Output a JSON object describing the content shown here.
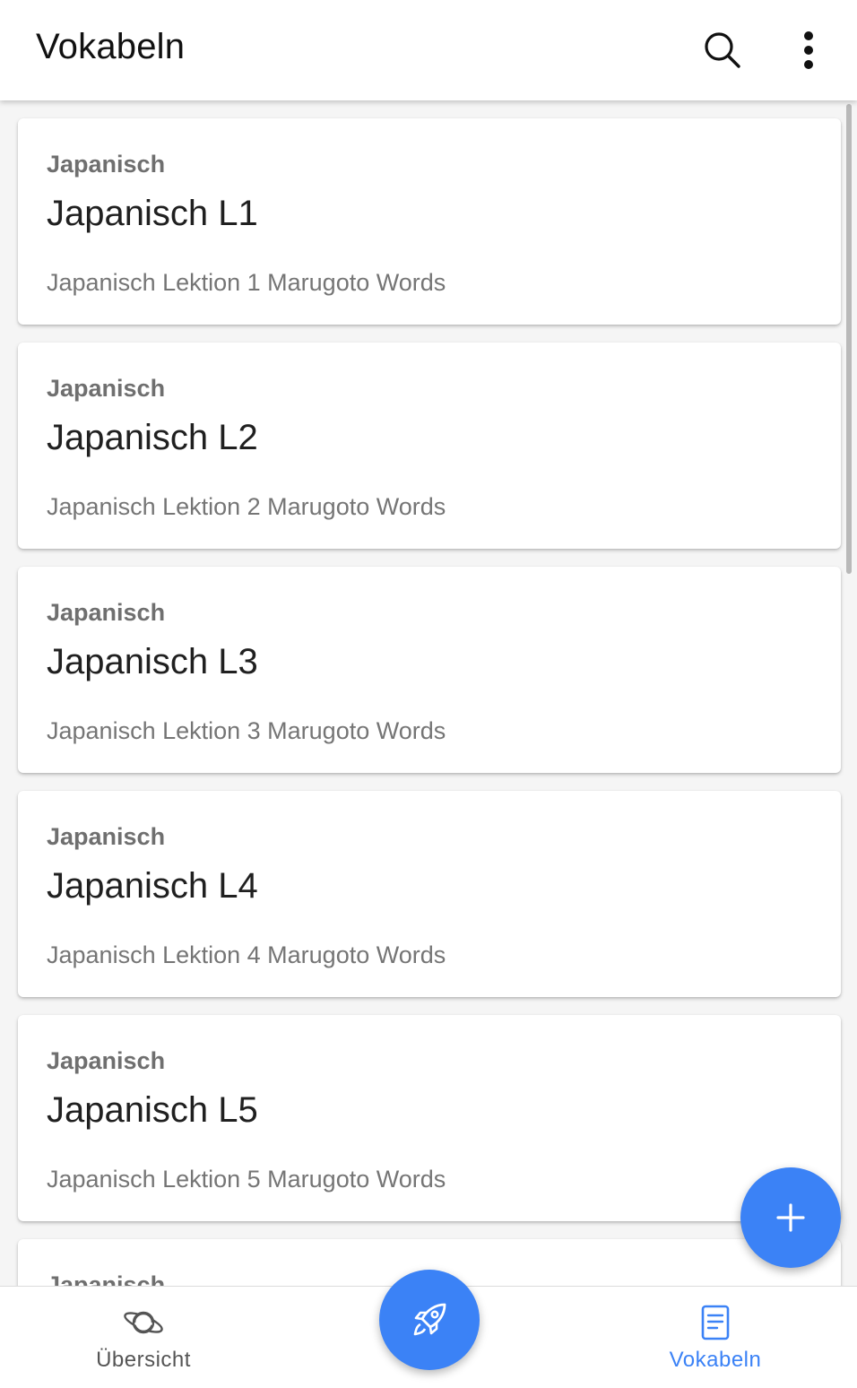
{
  "appbar": {
    "title": "Vokabeln",
    "icons": [
      "search-icon",
      "more-vert-icon"
    ]
  },
  "cards": [
    {
      "overline": "Japanisch",
      "title": "Japanisch L1",
      "subtitle": "Japanisch Lektion 1 Marugoto Words"
    },
    {
      "overline": "Japanisch",
      "title": "Japanisch L2",
      "subtitle": "Japanisch Lektion 2 Marugoto Words"
    },
    {
      "overline": "Japanisch",
      "title": "Japanisch L3",
      "subtitle": "Japanisch Lektion 3 Marugoto Words"
    },
    {
      "overline": "Japanisch",
      "title": "Japanisch L4",
      "subtitle": "Japanisch Lektion 4 Marugoto Words"
    },
    {
      "overline": "Japanisch",
      "title": "Japanisch L5",
      "subtitle": "Japanisch Lektion 5 Marugoto Words"
    },
    {
      "overline": "Japanisch",
      "title": "",
      "subtitle": ""
    }
  ],
  "fab": {
    "icon": "plus-icon"
  },
  "bottom_nav": {
    "items": [
      {
        "label": "Übersicht",
        "icon": "planet-icon",
        "active": false
      },
      {
        "label": "Vokabeln",
        "icon": "document-icon",
        "active": true
      }
    ],
    "center_icon": "rocket-icon"
  },
  "colors": {
    "accent": "#3b82f6",
    "background": "#f5f5f5",
    "card": "#ffffff",
    "text_primary": "#202020",
    "text_secondary": "#757575"
  }
}
